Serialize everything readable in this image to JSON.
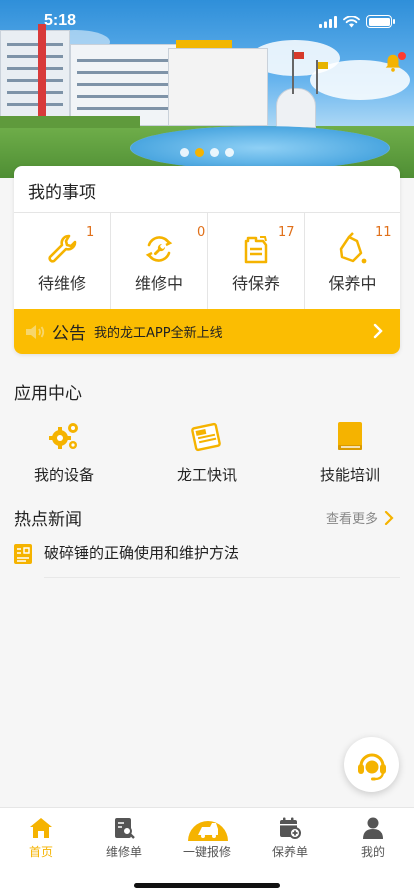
{
  "status": {
    "time": "5:18"
  },
  "banner": {
    "slides": 4,
    "active_slide": 2
  },
  "my_items": {
    "title": "我的事项",
    "stats": [
      {
        "label": "待维修",
        "count": "1",
        "icon": "wrench-icon"
      },
      {
        "label": "维修中",
        "count": "0",
        "icon": "repair-gear-icon"
      },
      {
        "label": "待保养",
        "count": "17",
        "icon": "oil-can-icon"
      },
      {
        "label": "保养中",
        "count": "11",
        "icon": "oil-pour-icon"
      }
    ],
    "notice": {
      "title": "公告",
      "text": "我的龙工APP全新上线"
    }
  },
  "apps": {
    "title": "应用中心",
    "items": [
      {
        "label": "我的设备",
        "icon": "gears-icon"
      },
      {
        "label": "龙工快讯",
        "icon": "newspaper-icon"
      },
      {
        "label": "技能培训",
        "icon": "book-icon"
      }
    ]
  },
  "news": {
    "title": "热点新闻",
    "more": "查看更多",
    "items": [
      {
        "title": "破碎锤的正确使用和维护方法"
      }
    ]
  },
  "tabbar": {
    "tabs": [
      {
        "label": "首页",
        "icon": "home-icon",
        "active": true
      },
      {
        "label": "维修单",
        "icon": "repair-order-icon",
        "active": false
      },
      {
        "label": "一键报修",
        "icon": "one-click-repair-icon",
        "active": false
      },
      {
        "label": "保养单",
        "icon": "maintenance-order-icon",
        "active": false
      },
      {
        "label": "我的",
        "icon": "profile-icon",
        "active": false
      }
    ]
  },
  "colors": {
    "accent": "#fbbd02",
    "count": "#e0701a",
    "active_tab": "#f5b300"
  }
}
